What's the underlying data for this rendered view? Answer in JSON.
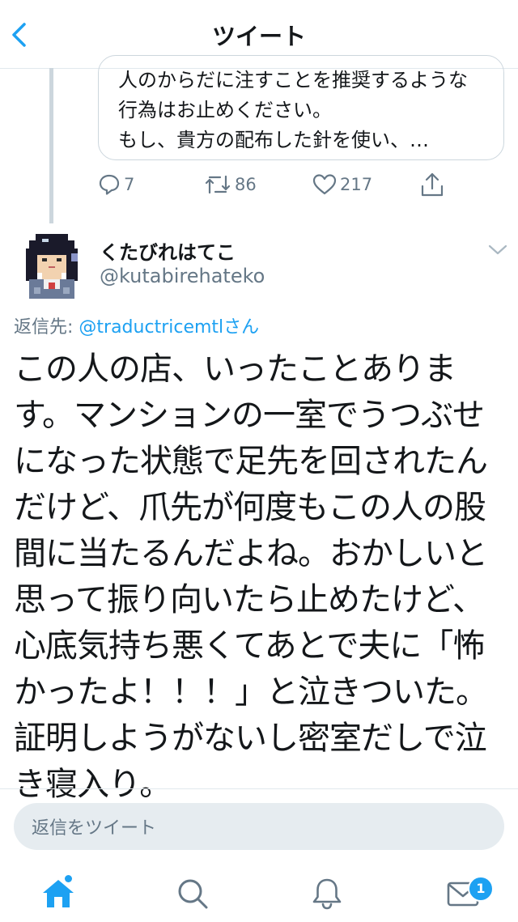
{
  "header": {
    "title": "ツイート",
    "back_icon": "chevron-left-icon"
  },
  "quoted_tweet": {
    "lines": [
      "人のからだに注すことを推奨するような",
      "行為はお止めください。",
      "もし、貴方の配布した針を使い、…"
    ]
  },
  "actions": {
    "reply_count": "7",
    "retweet_count": "86",
    "like_count": "217",
    "icons": [
      "reply-icon",
      "retweet-icon",
      "like-icon",
      "share-icon"
    ]
  },
  "reply_tweet": {
    "display_name": "くたびれはてこ",
    "handle": "@kutabirehateko",
    "reply_prefix": "返信先: ",
    "reply_mention": "@traductricemtl",
    "reply_suffix": "さん",
    "body_lines": [
      "この人の店、いったことありま",
      "す。マンションの一室でうつぶせ",
      "になった状態で足先を回されたん",
      "だけど、爪先が何度もこの人の股",
      "間に当たるんだよね。おかしいと",
      "思って振り向いたら止めたけど、",
      "心底気持ち悪くてあとで夫に「怖",
      "かったよ！！！」と泣きついた。",
      "証明しようがないし密室だしで泣",
      "き寝入り。"
    ]
  },
  "composer": {
    "placeholder": "返信をツイート"
  },
  "tabbar": {
    "tabs": [
      "home-icon",
      "search-icon",
      "notifications-icon",
      "messages-icon"
    ],
    "messages_badge": "1"
  },
  "colors": {
    "accent": "#1da1f2",
    "secondary_text": "#657786",
    "divider": "#e1e8ed",
    "input_bg": "#e6ecf0"
  }
}
